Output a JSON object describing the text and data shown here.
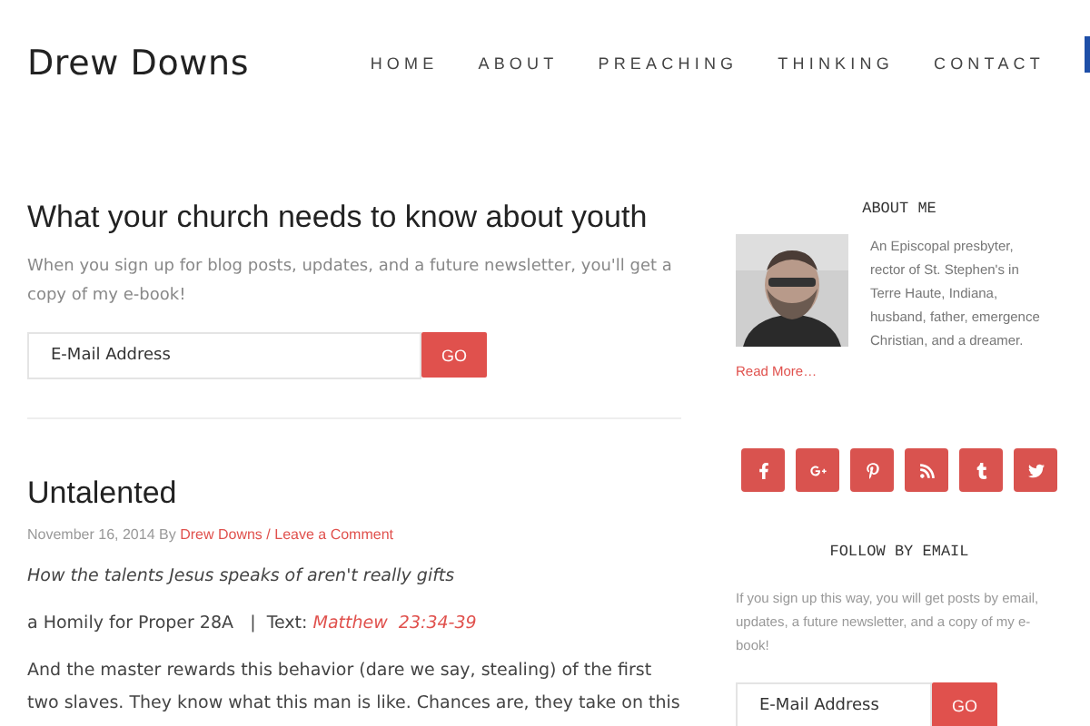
{
  "site": {
    "title": "Drew Downs"
  },
  "nav": [
    {
      "label": "HOME"
    },
    {
      "label": "ABOUT"
    },
    {
      "label": "PREACHING"
    },
    {
      "label": "THINKING"
    },
    {
      "label": "CONTACT"
    }
  ],
  "signup": {
    "heading": "What your church needs to know about youth",
    "text": "When you sign up for blog posts, updates, and a future newsletter, you'll get a copy of my e-book!",
    "placeholder": "E-Mail Address",
    "button": "GO"
  },
  "post": {
    "title": "Untalented",
    "date": "November 16, 2014",
    "by": "By",
    "author": "Drew Downs",
    "separator": "/",
    "comments": "Leave a Comment",
    "subtitle": "How the talents Jesus speaks of aren't really gifts",
    "homily": "a Homily for Proper 28A   |  Text:",
    "scripture": "Matthew  23:34-39",
    "paragraph": "And the master rewards this behavior (dare we say, stealing) of the first two slaves. They know what this man is like. Chances are, they take on this"
  },
  "sidebar": {
    "about_heading": "ABOUT ME",
    "about_text": "An Episcopal presbyter, rector of St. Stephen's in Terre Haute, Indiana, husband, father, emergence Christian, and a dreamer.",
    "read_more": "Read More…",
    "social": [
      {
        "kind": "facebook"
      },
      {
        "kind": "googleplus"
      },
      {
        "kind": "pinterest"
      },
      {
        "kind": "rss"
      },
      {
        "kind": "tumblr"
      },
      {
        "kind": "twitter"
      }
    ],
    "follow_heading": "FOLLOW BY EMAIL",
    "follow_text": "If you sign up this way, you will get posts by email, updates, a future newsletter, and a copy of my e-book!",
    "placeholder": "E-Mail Address",
    "button": "GO"
  }
}
